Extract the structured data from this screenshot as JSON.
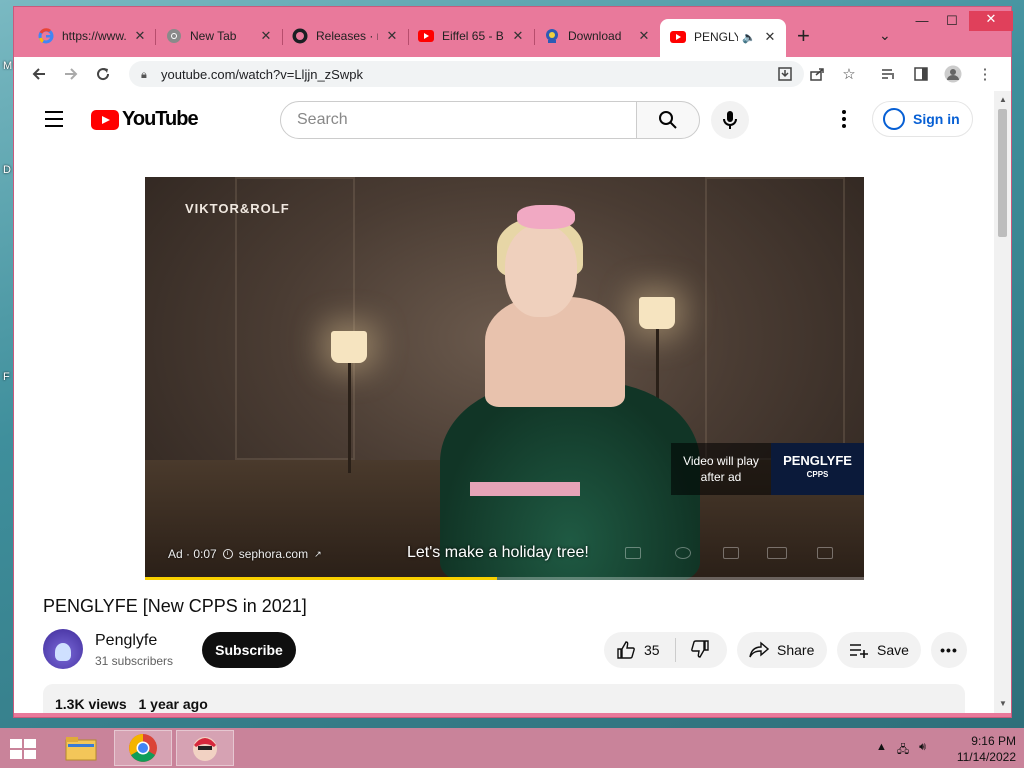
{
  "desktop": {
    "edge_letters": [
      "M",
      "D",
      "F"
    ]
  },
  "browser": {
    "tabs": [
      {
        "title": "https://www.",
        "icon": "google-icon"
      },
      {
        "title": "New Tab",
        "icon": "chrome-icon"
      },
      {
        "title": "Releases · n",
        "icon": "github-icon"
      },
      {
        "title": "Eiffel 65 - B",
        "icon": "youtube-icon"
      },
      {
        "title": "Download",
        "icon": "app-icon"
      },
      {
        "title": "PENGLY",
        "icon": "youtube-icon",
        "active": true,
        "audio": true
      }
    ],
    "url": "youtube.com/watch?v=Lljjn_zSwpk",
    "new_tab": "+",
    "tab_menu": "⌄",
    "window_controls": {
      "minimize": "—",
      "maximize": "☐",
      "close": "✕"
    }
  },
  "youtube": {
    "logo_text": "YouTube",
    "search_placeholder": "Search",
    "sign_in": "Sign in",
    "video": {
      "brand": "VIKTOR&ROLF",
      "caption": "Let's make a holiday tree!",
      "ad_label": "Ad · 0:07",
      "ad_link": "sephora.com",
      "play_after_ad": "Video will play after ad",
      "next_thumb_title": "PENGLYFE",
      "next_thumb_sub": "CPPS",
      "progress": 0.49
    },
    "title": "PENGLYFE [New CPPS in 2021]",
    "channel": {
      "name": "Penglyfe",
      "subscribers": "31 subscribers"
    },
    "subscribe_label": "Subscribe",
    "likes": "35",
    "share_label": "Share",
    "save_label": "Save",
    "views": "1.3K views",
    "age": "1 year ago"
  },
  "taskbar": {
    "time": "9:16 PM",
    "date": "11/14/2022"
  }
}
